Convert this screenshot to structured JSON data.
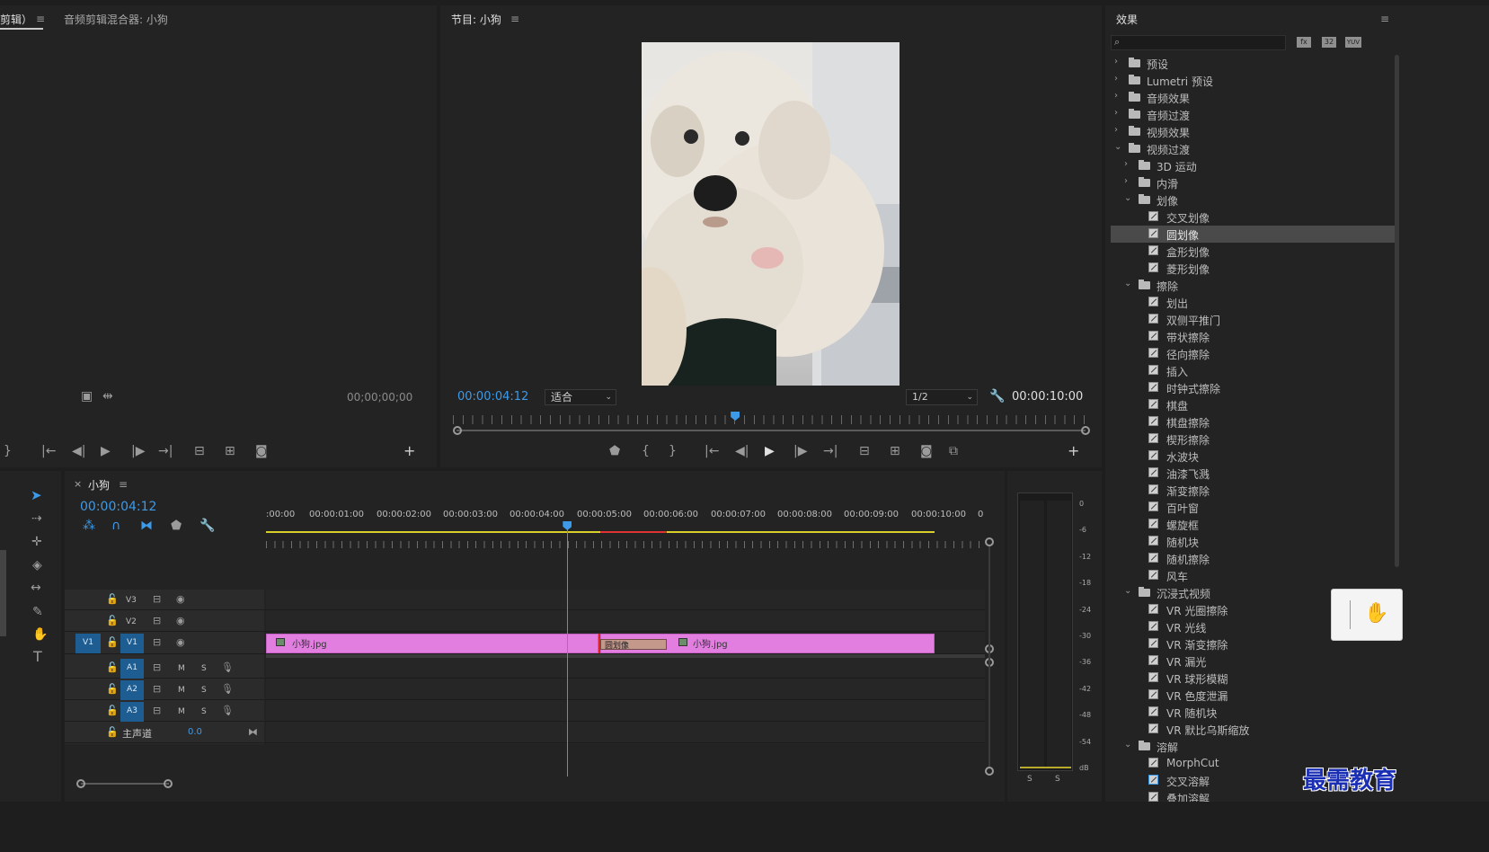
{
  "source_panel": {
    "tab_edit": "剪辑）",
    "tab_mixer": "音频剪辑混合器: 小狗",
    "timecode": "00;00;00;00"
  },
  "program_panel": {
    "title": "节目: 小狗",
    "timecode": "00:00:04:12",
    "fit_select": "适合",
    "resolution_select": "1/2",
    "duration": "00:00:10:00",
    "playhead_fraction": 0.445
  },
  "effects_panel": {
    "title": "效果",
    "search_placeholder": "",
    "filter_icons": [
      "fx-accelerated-icon",
      "32bit-icon",
      "yuv-icon"
    ],
    "filter_labels": [
      "fx",
      "32",
      "YUV"
    ],
    "items": [
      {
        "level": 0,
        "expanded": false,
        "folder": true,
        "label": "预设"
      },
      {
        "level": 0,
        "expanded": false,
        "folder": true,
        "label": "Lumetri 预设"
      },
      {
        "level": 0,
        "expanded": false,
        "folder": true,
        "label": "音频效果"
      },
      {
        "level": 0,
        "expanded": false,
        "folder": true,
        "label": "音频过渡"
      },
      {
        "level": 0,
        "expanded": false,
        "folder": true,
        "label": "视频效果"
      },
      {
        "level": 0,
        "expanded": true,
        "folder": true,
        "label": "视频过渡"
      },
      {
        "level": 1,
        "expanded": false,
        "folder": true,
        "label": "3D 运动"
      },
      {
        "level": 1,
        "expanded": false,
        "folder": true,
        "label": "内滑"
      },
      {
        "level": 1,
        "expanded": true,
        "folder": true,
        "label": "划像"
      },
      {
        "level": 2,
        "folder": false,
        "label": "交叉划像"
      },
      {
        "level": 2,
        "folder": false,
        "label": "圆划像",
        "selected": true
      },
      {
        "level": 2,
        "folder": false,
        "label": "盒形划像"
      },
      {
        "level": 2,
        "folder": false,
        "label": "菱形划像"
      },
      {
        "level": 1,
        "expanded": true,
        "folder": true,
        "label": "擦除"
      },
      {
        "level": 2,
        "folder": false,
        "label": "划出"
      },
      {
        "level": 2,
        "folder": false,
        "label": "双侧平推门"
      },
      {
        "level": 2,
        "folder": false,
        "label": "带状擦除"
      },
      {
        "level": 2,
        "folder": false,
        "label": "径向擦除"
      },
      {
        "level": 2,
        "folder": false,
        "label": "插入"
      },
      {
        "level": 2,
        "folder": false,
        "label": "时钟式擦除"
      },
      {
        "level": 2,
        "folder": false,
        "label": "棋盘"
      },
      {
        "level": 2,
        "folder": false,
        "label": "棋盘擦除"
      },
      {
        "level": 2,
        "folder": false,
        "label": "楔形擦除"
      },
      {
        "level": 2,
        "folder": false,
        "label": "水波块"
      },
      {
        "level": 2,
        "folder": false,
        "label": "油漆飞溅"
      },
      {
        "level": 2,
        "folder": false,
        "label": "渐变擦除"
      },
      {
        "level": 2,
        "folder": false,
        "label": "百叶窗"
      },
      {
        "level": 2,
        "folder": false,
        "label": "螺旋框"
      },
      {
        "level": 2,
        "folder": false,
        "label": "随机块"
      },
      {
        "level": 2,
        "folder": false,
        "label": "随机擦除"
      },
      {
        "level": 2,
        "folder": false,
        "label": "风车"
      },
      {
        "level": 1,
        "expanded": true,
        "folder": true,
        "label": "沉浸式视频"
      },
      {
        "level": 2,
        "folder": false,
        "label": "VR 光圈擦除"
      },
      {
        "level": 2,
        "folder": false,
        "label": "VR 光线"
      },
      {
        "level": 2,
        "folder": false,
        "label": "VR 渐变擦除"
      },
      {
        "level": 2,
        "folder": false,
        "label": "VR 漏光"
      },
      {
        "level": 2,
        "folder": false,
        "label": "VR 球形模糊"
      },
      {
        "level": 2,
        "folder": false,
        "label": "VR 色度泄漏"
      },
      {
        "level": 2,
        "folder": false,
        "label": "VR 随机块"
      },
      {
        "level": 2,
        "folder": false,
        "label": "VR 默比乌斯缩放"
      },
      {
        "level": 1,
        "expanded": true,
        "folder": true,
        "label": "溶解"
      },
      {
        "level": 2,
        "folder": false,
        "label": "MorphCut"
      },
      {
        "level": 2,
        "folder": false,
        "label": "交叉溶解",
        "outlined": true
      },
      {
        "level": 2,
        "folder": false,
        "label": "叠加溶解"
      }
    ]
  },
  "timeline": {
    "tab_close": "×",
    "sequence_name": "小狗",
    "timecode": "00:00:04:12",
    "ruler_labels": [
      ":00:00",
      "00:00:01:00",
      "00:00:02:00",
      "00:00:03:00",
      "00:00:04:00",
      "00:00:05:00",
      "00:00:06:00",
      "00:00:07:00",
      "00:00:08:00",
      "00:00:09:00",
      "00:00:10:00",
      "0"
    ],
    "video_tracks": [
      {
        "name": "V3"
      },
      {
        "name": "V2"
      },
      {
        "name": "V1",
        "source": "V1"
      }
    ],
    "audio_tracks": [
      {
        "name": "A1",
        "m": "M",
        "s": "S"
      },
      {
        "name": "A2",
        "m": "M",
        "s": "S"
      },
      {
        "name": "A3",
        "m": "M",
        "s": "S"
      }
    ],
    "master": {
      "label": "主声道",
      "value": "0.0"
    },
    "clip1_name": "小狗.jpg",
    "clip2_name": "小狗.jpg",
    "transition_name": "圆划像",
    "playhead_seconds": 4.4
  },
  "audio_meter": {
    "scale": [
      "0",
      "-6",
      "-12",
      "-18",
      "-24",
      "-30",
      "-36",
      "-42",
      "-48",
      "-54",
      "dB"
    ],
    "solo_labels": [
      "S",
      "S"
    ]
  },
  "watermark": "最需教育"
}
